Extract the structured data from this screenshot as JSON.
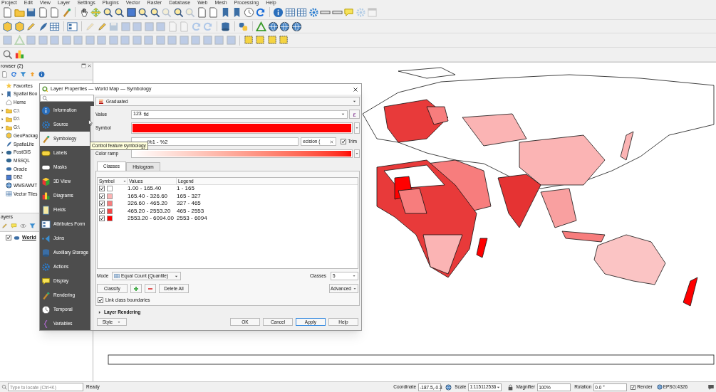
{
  "menu_bar": [
    "Project",
    "Edit",
    "View",
    "Layer",
    "Settings",
    "Plugins",
    "Vector",
    "Raster",
    "Database",
    "Web",
    "Mesh",
    "Processing",
    "Help"
  ],
  "browser_panel": {
    "title": "rowser (2)",
    "items": [
      {
        "label": "Favorites",
        "expandable": false
      },
      {
        "label": "Spatial Boo",
        "expandable": true
      },
      {
        "label": "Home",
        "expandable": false
      },
      {
        "label": "C:\\",
        "expandable": true
      },
      {
        "label": "D:\\",
        "expandable": true
      },
      {
        "label": "G:\\",
        "expandable": true
      },
      {
        "label": "GeoPackag",
        "expandable": false
      },
      {
        "label": "SpatiaLite",
        "expandable": false
      },
      {
        "label": "PostGIS",
        "expandable": true
      },
      {
        "label": "MSSQL",
        "expandable": false
      },
      {
        "label": "Oracle",
        "expandable": false
      },
      {
        "label": "DB2",
        "expandable": false
      },
      {
        "label": "WMS/WMT",
        "expandable": false
      },
      {
        "label": "Vector Tiles",
        "expandable": false
      }
    ]
  },
  "layers_panel": {
    "title": "ayers",
    "layers": [
      {
        "name": "World",
        "checked": true
      }
    ]
  },
  "dialog": {
    "title": "Layer Properties — World Map — Symbology",
    "sidebar": [
      {
        "label": "Information",
        "selected": false
      },
      {
        "label": "Source",
        "selected": false
      },
      {
        "label": "Symbology",
        "selected": true
      },
      {
        "label": "Labels",
        "selected": false
      },
      {
        "label": "Masks",
        "selected": false
      },
      {
        "label": "3D View",
        "selected": false
      },
      {
        "label": "Diagrams",
        "selected": false
      },
      {
        "label": "Fields",
        "selected": false
      },
      {
        "label": "Attributes Form",
        "selected": false
      },
      {
        "label": "Joins",
        "selected": false
      },
      {
        "label": "Auxiliary Storage",
        "selected": false
      },
      {
        "label": "Actions",
        "selected": false
      },
      {
        "label": "Display",
        "selected": false
      },
      {
        "label": "Rendering",
        "selected": false
      },
      {
        "label": "Temporal",
        "selected": false
      },
      {
        "label": "Variables",
        "selected": false
      }
    ],
    "renderer": "Graduated",
    "value_label": "Value",
    "value_type": "123",
    "value": "fid",
    "expression_button": "ε",
    "symbol_label": "Symbol",
    "legend_format": "%1 - %2",
    "precision": "ecision (",
    "trim": {
      "label": "Trim",
      "checked": true
    },
    "color_ramp_label": "Color ramp",
    "tabs": [
      {
        "label": "Classes",
        "selected": true
      },
      {
        "label": "Histogram",
        "selected": false
      }
    ],
    "table": {
      "columns": [
        "Symbol",
        "Values",
        "Legend"
      ],
      "rows": [
        {
          "checked": true,
          "color": "#ffffff",
          "values": "1.00 - 165.40",
          "legend": "1 - 165"
        },
        {
          "checked": true,
          "color": "#fbb4b4",
          "values": "165.40 - 326.60",
          "legend": "165 - 327"
        },
        {
          "checked": true,
          "color": "#f77d7d",
          "values": "326.60 - 465.20",
          "legend": "327 - 465"
        },
        {
          "checked": true,
          "color": "#f34747",
          "values": "465.20 - 2553.20",
          "legend": "465 - 2553"
        },
        {
          "checked": true,
          "color": "#ff0000",
          "values": "2553.20 - 6094.00",
          "legend": "2553 - 6094"
        }
      ]
    },
    "mode_label": "Mode",
    "mode": "Equal Count (Quantile)",
    "classes_label": "Classes",
    "classes": "5",
    "classify_button": "Classify",
    "delete_all_button": "Delete All",
    "advanced_button": "Advanced",
    "link_boundaries": {
      "label": "Link class boundaries",
      "checked": true
    },
    "layer_rendering": {
      "label": "Layer Rendering",
      "expanded": false
    },
    "style_button": "Style",
    "footer_buttons": [
      {
        "label": "OK",
        "focused": false
      },
      {
        "label": "Cancel",
        "focused": false
      },
      {
        "label": "Apply",
        "focused": true
      },
      {
        "label": "Help",
        "focused": false
      }
    ]
  },
  "tooltip": "Control feature symbology",
  "status_bar": {
    "locate_placeholder": "Type to locate (Ctrl+K)",
    "message": "Ready",
    "coordinate_label": "Coordinate",
    "coordinate": "-187.5,-0.3",
    "scale_label": "Scale",
    "scale": "1:115112536",
    "magnifier_label": "Magnifier",
    "magnifier": "100%",
    "rotation_label": "Rotation",
    "rotation": "0.0 °",
    "render": {
      "label": "Render",
      "checked": true
    },
    "crs": "EPSG:4326"
  }
}
